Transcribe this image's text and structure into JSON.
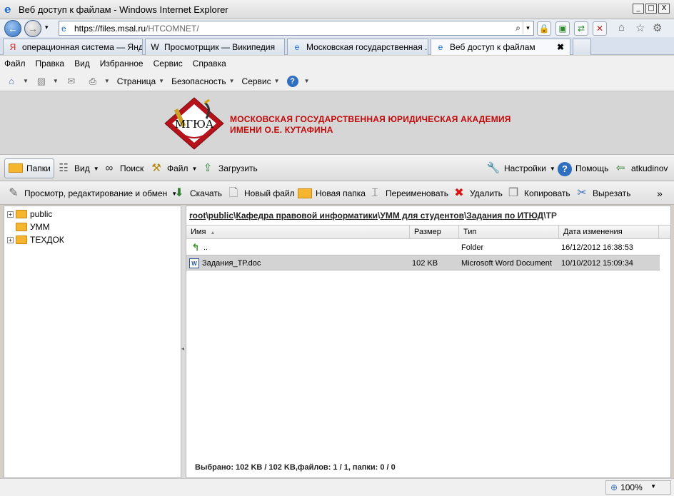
{
  "window": {
    "title": "Веб доступ к файлам - Windows Internet Explorer",
    "buttons": [
      "_",
      "□",
      "X"
    ]
  },
  "address": {
    "scheme": "https://",
    "host": "files.msal.ru",
    "path": "/HTCOMNET/"
  },
  "tabs": [
    {
      "label": "операционная система — Янд...",
      "icon": "Я",
      "icon_color": "#d2231c"
    },
    {
      "label": "Просмотрщик — Википедия",
      "icon": "W",
      "icon_color": "#000000"
    },
    {
      "label": "Московская государственная ...",
      "icon": "e",
      "icon_color": "#1c6ed2"
    },
    {
      "label": "Веб доступ к файлам",
      "icon": "e",
      "icon_color": "#1c6ed2",
      "close": "✖"
    }
  ],
  "menu": [
    "Файл",
    "Правка",
    "Вид",
    "Избранное",
    "Сервис",
    "Справка"
  ],
  "command_bar": [
    "Страница",
    "Безопасность",
    "Сервис"
  ],
  "banner": {
    "logo_text": "МГЮА",
    "line1": "МОСКОВСКАЯ ГОСУДАРСТВЕННАЯ ЮРИДИЧЕСКАЯ АКАДЕМИЯ",
    "line2": "ИМЕНИ О.Е. КУТАФИНА"
  },
  "appbar": {
    "folders": "Папки",
    "view": "Вид",
    "search": "Поиск",
    "file": "Файл",
    "upload": "Загрузить",
    "settings": "Настройки",
    "help": "Помощь",
    "user": "atkudinov"
  },
  "actions": {
    "view_edit": "Просмотр, редактирование и обмен",
    "download": "Скачать",
    "new_file": "Новый файл",
    "new_folder": "Новая папка",
    "rename": "Переименовать",
    "delete": "Удалить",
    "copy": "Копировать",
    "cut": "Вырезать",
    "more": "»"
  },
  "tree": [
    {
      "label": "public",
      "expand": "+"
    },
    {
      "label": "УММ",
      "expand": ""
    },
    {
      "label": "ТЕХДОК",
      "expand": "+"
    }
  ],
  "breadcrumb": {
    "parts": [
      "root",
      "public",
      "Кафедра правовой информатики",
      "УММ для студентов",
      "Задания по ИТЮД"
    ],
    "current": "ТР",
    "sep": "\\"
  },
  "columns": {
    "name": "Имя",
    "size": "Размер",
    "type": "Тип",
    "modified": "Дата изменения",
    "sort_arrow": "▲"
  },
  "rows": [
    {
      "name": "..",
      "size": "",
      "type": "Folder",
      "modified": "16/12/2012 16:38:53"
    },
    {
      "name": "Задания_ТР.doc",
      "size": "102 KB",
      "type": "Microsoft Word Document",
      "modified": "10/10/2012 15:09:34",
      "icon_text": "W"
    }
  ],
  "selection_status": "Выбрано: 102 KB / 102 KB,файлов: 1 / 1, папки: 0 / 0",
  "zoom": "100%"
}
